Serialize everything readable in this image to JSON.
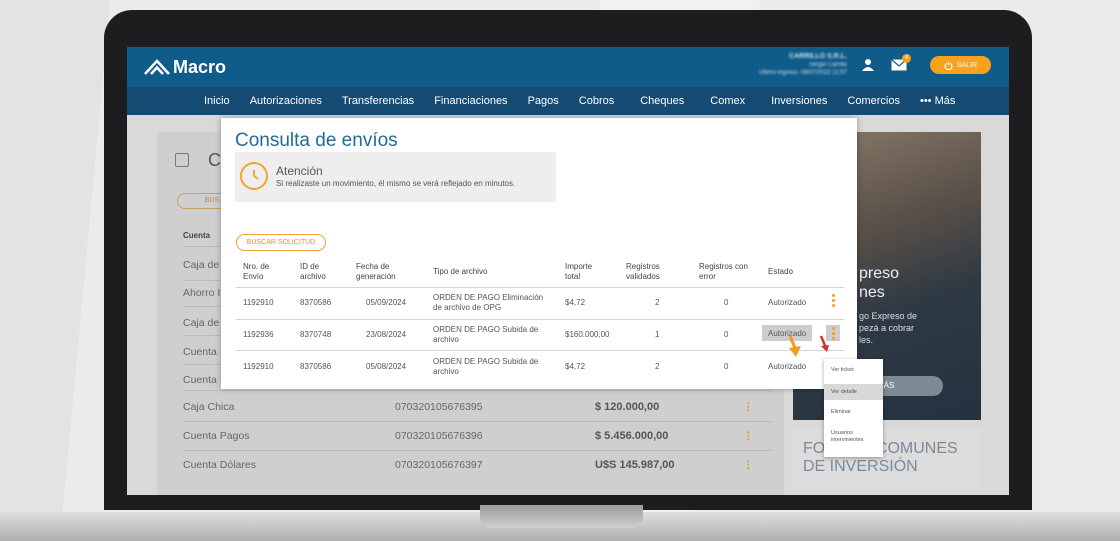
{
  "header": {
    "logo_text": "Macro",
    "user_name": "CARRILLO S.R.L.",
    "user_sub": "Sergio Carrillo",
    "last_login": "Último ingreso: 08/07/2022 11:57",
    "mail_count": "4",
    "logout_label": "SALIR"
  },
  "nav": {
    "items": [
      "Inicio",
      "Autorizaciones",
      "Transferencias",
      "Financiaciones",
      "Pagos",
      "Cobros",
      "Cheques",
      "Comex",
      "Inversiones",
      "Comercios"
    ],
    "more_label": "••• Más"
  },
  "page": {
    "title_fragment": "Cu",
    "search_btn_fragment": "BUS",
    "col_header": "Cuenta",
    "rows_left": [
      "Caja de",
      "Ahorro I",
      "Caja de",
      "Cuenta",
      "Cuenta"
    ],
    "accounts": [
      {
        "name": "Caja Chica",
        "number": "070320105676395",
        "balance": "$ 120.000,00"
      },
      {
        "name": "Cuenta Pagos",
        "number": "070320105676396",
        "balance": "$ 5.456.000,00"
      },
      {
        "name": "Cuenta Dólares",
        "number": "070320105676397",
        "balance": "U$S 145.987,00"
      }
    ]
  },
  "promo": {
    "title_line1": "preso",
    "title_line2": "nes",
    "text_line1": "go Expreso de",
    "text_line2": "pezá a cobrar",
    "text_line3": "les.",
    "button": "MÁS",
    "fondos_line1": "FONDOS COMUNES",
    "fondos_line2": "DE INVERSIÓN"
  },
  "modal": {
    "title": "Consulta de envíos",
    "alert_title": "Atención",
    "alert_text": "Si realizaste un movimiento, él mismo se verá reflejado en minutos.",
    "search_button": "BUSCAR SOLICITUD",
    "headers": {
      "nro_1": "Nro. de",
      "nro_2": "Envío",
      "id_1": "ID de",
      "id_2": "archivo",
      "fecha_1": "Fecha de",
      "fecha_2": "generación",
      "tipo": "Tipo de archivo",
      "importe_1": "Importe",
      "importe_2": "total",
      "reg_val_1": "Registros",
      "reg_val_2": "validados",
      "reg_err_1": "Registros con",
      "reg_err_2": "error",
      "estado": "Estado"
    },
    "rows": [
      {
        "nro": "1192910",
        "id": "8370586",
        "fecha": "05/09/2024",
        "tipo_1": "ORDEN DE PAGO Eliminación",
        "tipo_2": "de archivo de OPG",
        "importe": "$4,72",
        "validados": "2",
        "errores": "0",
        "estado": "Autorizado"
      },
      {
        "nro": "1192936",
        "id": "8370748",
        "fecha": "23/08/2024",
        "tipo_1": "ORDEN DE PAGO Subida de",
        "tipo_2": "archivo",
        "importe": "$160.000,00",
        "validados": "1",
        "errores": "0",
        "estado": "Autorizado"
      },
      {
        "nro": "1192910",
        "id": "8370586",
        "fecha": "05/08/2024",
        "tipo_1": "ORDEN DE PAGO Subida de",
        "tipo_2": "archivo",
        "importe": "$4,72",
        "validados": "2",
        "errores": "0",
        "estado": "Autorizado"
      }
    ]
  },
  "context_menu": {
    "items": [
      "Ver ticket",
      "Ver detalle",
      "Eliminar",
      "Usuarios",
      "intervinientes"
    ]
  },
  "colors": {
    "brand_blue": "#0f5b8a",
    "nav_blue": "#154a73",
    "accent_orange": "#f7a21b"
  }
}
